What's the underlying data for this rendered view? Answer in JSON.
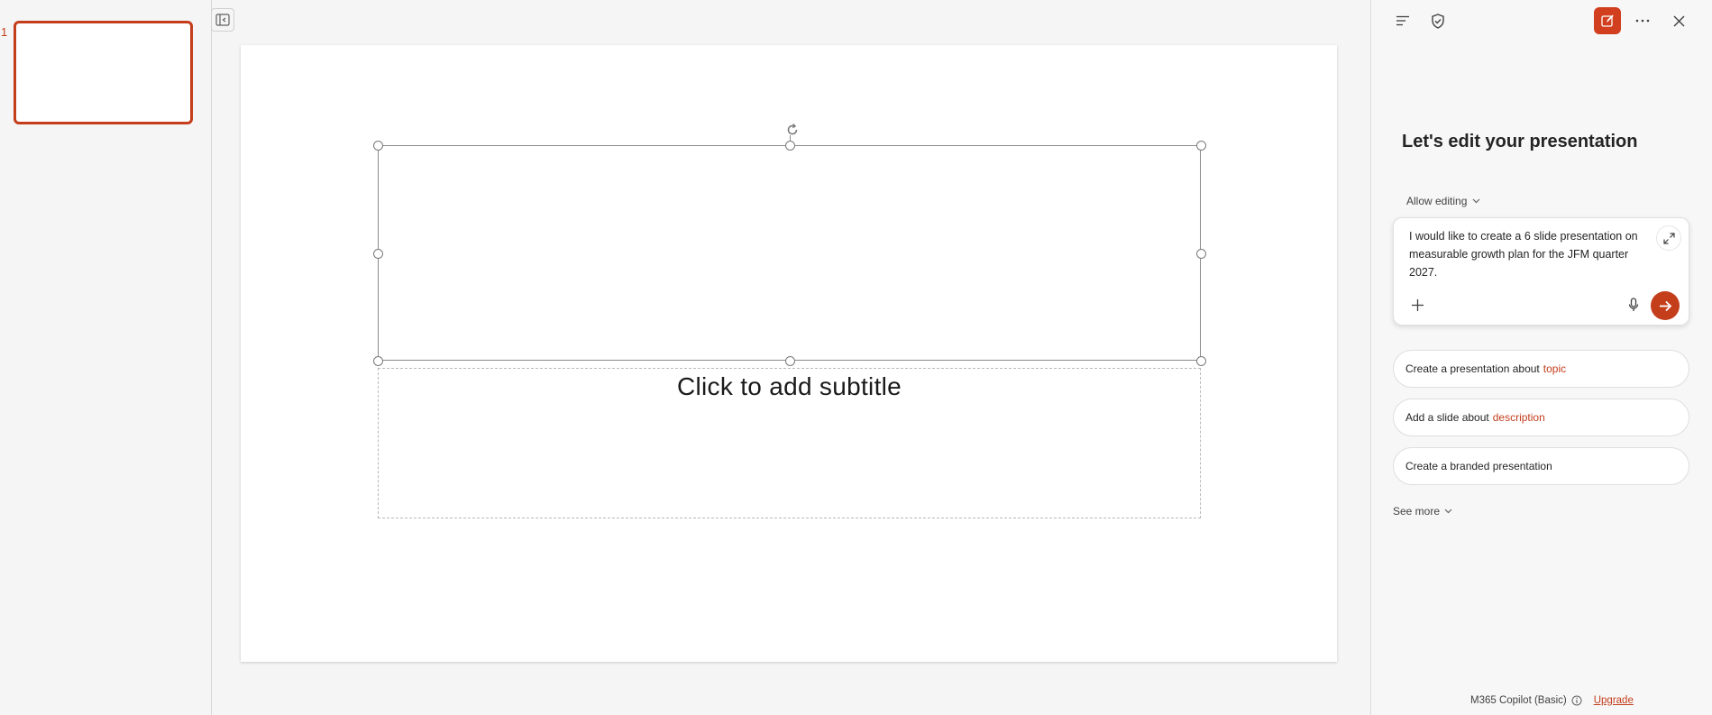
{
  "thumbnails": {
    "slides": [
      {
        "number": "1"
      }
    ]
  },
  "slide": {
    "subtitle_placeholder": "Click to add subtitle"
  },
  "copilot": {
    "heading": "Let's edit your presentation",
    "allow_editing_label": "Allow editing",
    "prompt_text": "I would like to create a 6 slide presentation on measurable growth plan for the JFM quarter 2027.",
    "suggestions": [
      {
        "prefix": "Create a presentation about",
        "highlight": "topic"
      },
      {
        "prefix": "Add a slide about",
        "highlight": "description"
      },
      {
        "prefix": "Create a branded presentation",
        "highlight": ""
      }
    ],
    "see_more_label": "See more",
    "footer_label": "M365 Copilot (Basic)",
    "upgrade_label": "Upgrade",
    "accent_color": "#c43e1c",
    "icons": [
      "menu-icon",
      "shield-check-icon",
      "new-chat-icon",
      "more-icon",
      "close-icon",
      "expand-icon",
      "plus-icon",
      "microphone-icon",
      "arrow-right-icon",
      "info-icon"
    ]
  }
}
